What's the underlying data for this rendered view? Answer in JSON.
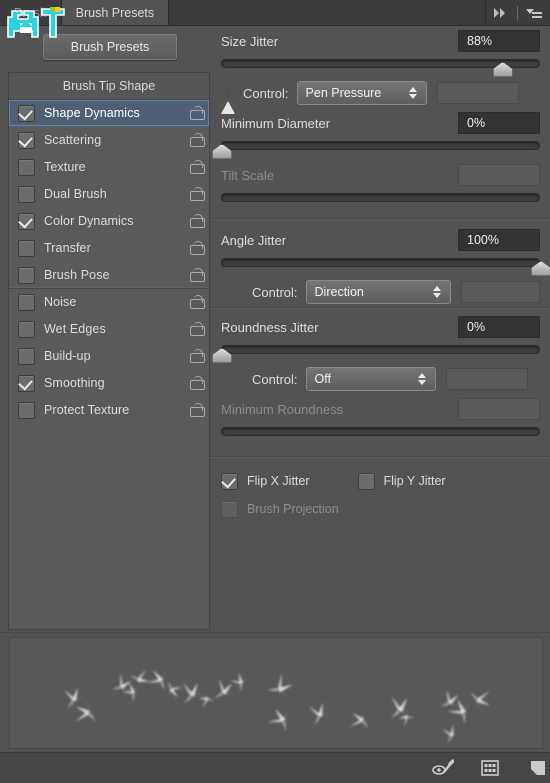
{
  "window": {
    "tabs": [
      {
        "label": "Brush",
        "active": false
      },
      {
        "label": "Brush Presets",
        "active": true
      }
    ],
    "collapse_icon": "double-chevron-right-icon",
    "menu_icon": "panel-menu-icon",
    "watermark": "pixel-logo-watermark"
  },
  "toolbar": {
    "presets_button": "Brush Presets"
  },
  "sidebar": {
    "header": "Brush Tip Shape",
    "items": [
      {
        "label": "Shape Dynamics",
        "checked": true,
        "selected": true,
        "locked": false,
        "divider": false
      },
      {
        "label": "Scattering",
        "checked": true,
        "selected": false,
        "locked": false,
        "divider": false
      },
      {
        "label": "Texture",
        "checked": false,
        "selected": false,
        "locked": false,
        "divider": false
      },
      {
        "label": "Dual Brush",
        "checked": false,
        "selected": false,
        "locked": false,
        "divider": false
      },
      {
        "label": "Color Dynamics",
        "checked": true,
        "selected": false,
        "locked": false,
        "divider": false
      },
      {
        "label": "Transfer",
        "checked": false,
        "selected": false,
        "locked": false,
        "divider": false
      },
      {
        "label": "Brush Pose",
        "checked": false,
        "selected": false,
        "locked": false,
        "divider": true
      },
      {
        "label": "Noise",
        "checked": false,
        "selected": false,
        "locked": false,
        "divider": false
      },
      {
        "label": "Wet Edges",
        "checked": false,
        "selected": false,
        "locked": false,
        "divider": false
      },
      {
        "label": "Build-up",
        "checked": false,
        "selected": false,
        "locked": false,
        "divider": false
      },
      {
        "label": "Smoothing",
        "checked": true,
        "selected": false,
        "locked": false,
        "divider": false
      },
      {
        "label": "Protect Texture",
        "checked": false,
        "selected": false,
        "locked": false,
        "divider": false
      }
    ]
  },
  "options": {
    "size_jitter": {
      "label": "Size Jitter",
      "value": "88%",
      "slider_percent": 88,
      "control_label": "Control:",
      "control_value": "Pen Pressure",
      "warning_icon": "warning-triangle-icon",
      "control_extra_value": ""
    },
    "minimum_diameter": {
      "label": "Minimum Diameter",
      "value": "0%",
      "slider_percent": 0
    },
    "tilt_scale": {
      "label": "Tilt Scale",
      "value": "",
      "slider_percent": 0,
      "disabled": true
    },
    "angle_jitter": {
      "label": "Angle Jitter",
      "value": "100%",
      "slider_percent": 100,
      "control_label": "Control:",
      "control_value": "Direction",
      "control_extra_value": ""
    },
    "roundness_jitter": {
      "label": "Roundness Jitter",
      "value": "0%",
      "slider_percent": 0,
      "control_label": "Control:",
      "control_value": "Off",
      "control_extra_value": ""
    },
    "minimum_roundness": {
      "label": "Minimum Roundness",
      "value": "",
      "slider_percent": 0,
      "disabled": true
    },
    "checkboxes": [
      {
        "label": "Flip X Jitter",
        "checked": true,
        "disabled": false
      },
      {
        "label": "Flip Y Jitter",
        "checked": false,
        "disabled": false
      },
      {
        "label": "Brush Projection",
        "checked": false,
        "disabled": true
      }
    ]
  },
  "footer": {
    "icons": [
      {
        "name": "toggle-brush-preview-icon"
      },
      {
        "name": "brush-presets-grid-icon"
      },
      {
        "name": "create-new-brush-icon"
      }
    ]
  },
  "colors": {
    "panel_bg": "#535353",
    "tab_bg": "#3d3d3d",
    "selection": "#4e5f75",
    "value_field": "#333333",
    "text": "#dcdcdc",
    "text_dim": "#8c8c8c",
    "watermark": "#2ad3e0"
  }
}
